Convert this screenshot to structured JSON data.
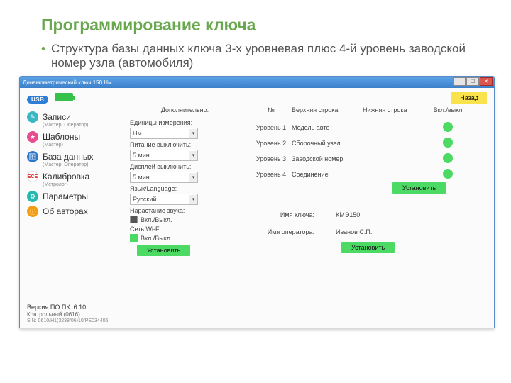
{
  "slide": {
    "title": "Программирование ключа",
    "bullet": "Структура базы данных ключа 3-х уровневая плюс 4-й уровень заводской номер узла (автомобиля)"
  },
  "window": {
    "title": "Динамометрический ключ 150 Нм",
    "usb": "USB",
    "back": "Назад"
  },
  "sidebar": [
    {
      "label": "Записи",
      "role": "(Мастер, Оператор)",
      "color": "#3bb6c4"
    },
    {
      "label": "Шаблоны",
      "role": "(Мастер)",
      "color": "#e74c8c"
    },
    {
      "label": "База данных",
      "role": "(Мастер, Оператор)",
      "color": "#2f78c9"
    },
    {
      "label": "Калибровка",
      "role": "(Метролог)",
      "color": "#e02f2f"
    },
    {
      "label": "Параметры",
      "role": "",
      "color": "#27b8b0"
    },
    {
      "label": "Об авторах",
      "role": "",
      "color": "#f39c12"
    }
  ],
  "additional": {
    "header": "Дополнительно:",
    "unitsLabel": "Единицы измерения:",
    "unitsValue": "Нм",
    "powerOffLabel": "Питание выключить:",
    "powerOffValue": "5 мин.",
    "displayOffLabel": "Дисплей выключить:",
    "displayOffValue": "5 мин.",
    "langLabel": "Язык/Language:",
    "langValue": "Русский",
    "soundLabel": "Нарастание звука:",
    "wifiLabel": "Сеть Wi-Fi:",
    "chkText": "Вкл./Выкл.",
    "setBtn": "Установить"
  },
  "levels": {
    "hdr": {
      "num": "№",
      "top": "Верхняя строка",
      "bot": "Нижняя строка",
      "sw": "Вкл./выкл"
    },
    "rows": [
      {
        "num": "Уровень 1",
        "top": "Модель авто"
      },
      {
        "num": "Уровень 2",
        "top": "Сборочный узел"
      },
      {
        "num": "Уровень 3",
        "top": "Заводской номер"
      },
      {
        "num": "Уровень 4",
        "top": "Соединение"
      }
    ],
    "setBtn": "Установить"
  },
  "names": {
    "keyLabel": "Имя ключа:",
    "keyValue": "КМЭ150",
    "opLabel": "Имя оператора:",
    "opValue": "Иванов С.П.",
    "setBtn": "Установить"
  },
  "footer": {
    "v1": "Версия ПО ПК: 6.10",
    "v2": "Контрольный (0616)",
    "v3": "S.N: 0610/H1(3238/06)10/PE034406"
  }
}
